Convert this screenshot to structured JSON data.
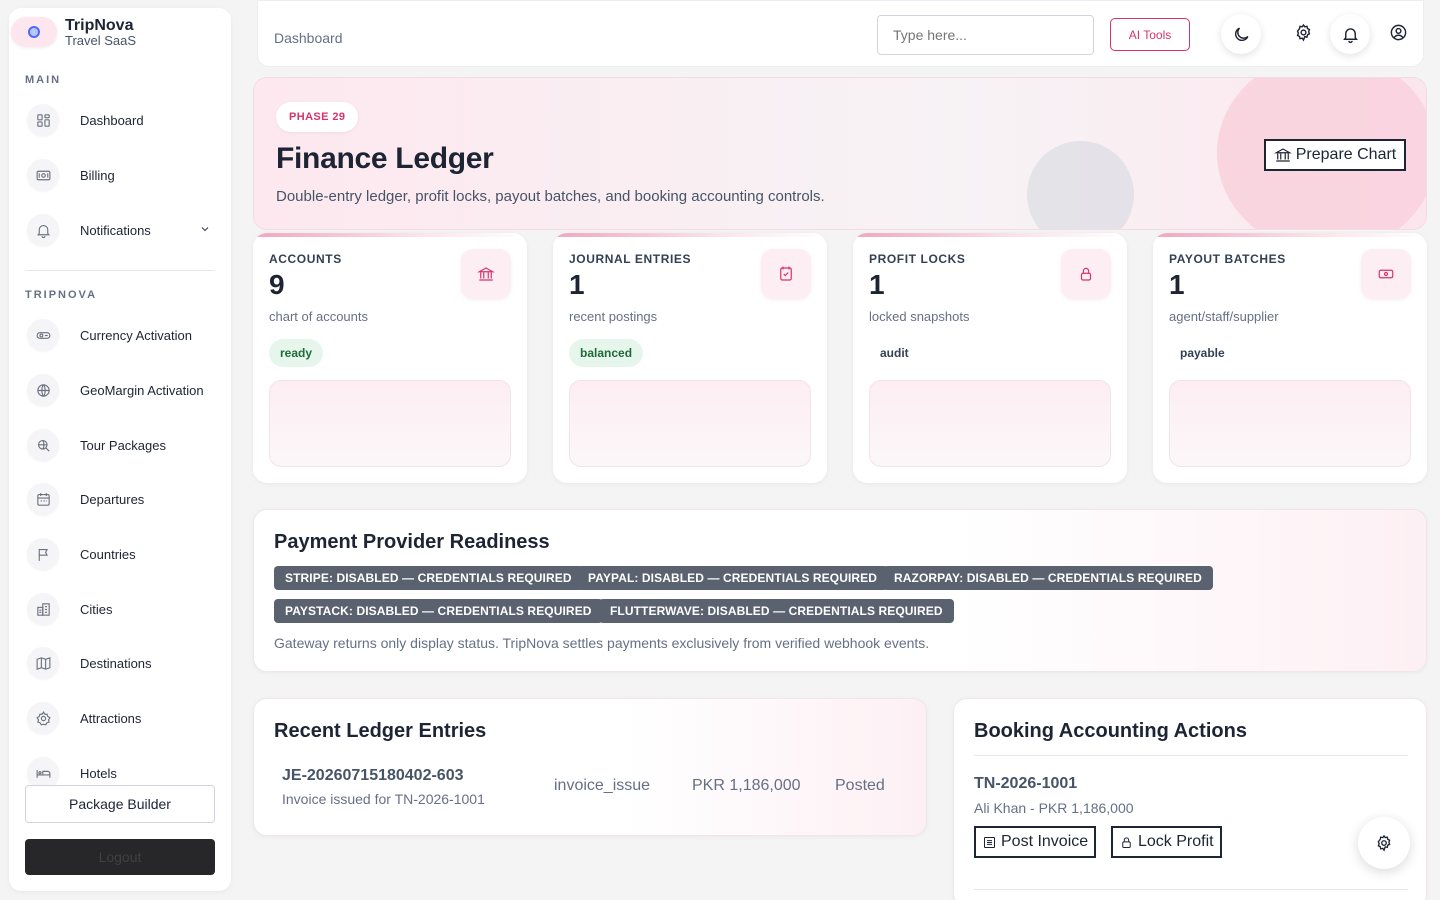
{
  "sidebar": {
    "brand": {
      "name": "TripNova",
      "subtitle": "Travel SaaS"
    },
    "main_label": "MAIN",
    "main_items": [
      {
        "label": "Dashboard",
        "icon": "dashboard-icon"
      },
      {
        "label": "Billing",
        "icon": "billing-icon"
      },
      {
        "label": "Notifications",
        "icon": "bell-icon",
        "chevron": "⌄"
      }
    ],
    "tripnova_label": "TRIPNOVA",
    "tripnova_items": [
      {
        "label": "Currency Activation",
        "icon": "currency-icon"
      },
      {
        "label": "GeoMargin Activation",
        "icon": "globe-icon"
      },
      {
        "label": "Tour Packages",
        "icon": "search-globe-icon"
      },
      {
        "label": "Departures",
        "icon": "calendar-icon"
      },
      {
        "label": "Countries",
        "icon": "flag-icon"
      },
      {
        "label": "Cities",
        "icon": "buildings-icon"
      },
      {
        "label": "Destinations",
        "icon": "map-icon"
      },
      {
        "label": "Attractions",
        "icon": "attractions-icon"
      },
      {
        "label": "Hotels",
        "icon": "bed-icon"
      }
    ],
    "package_builder": "Package Builder",
    "logout": "Logout"
  },
  "header": {
    "breadcrumb": "Dashboard",
    "search_placeholder": "Type here...",
    "ai_tools": "AI Tools"
  },
  "hero": {
    "phase": "PHASE 29",
    "title": "Finance Ledger",
    "subtitle": "Double-entry ledger, profit locks, payout batches, and booking accounting controls.",
    "prepare_chart": "Prepare Chart"
  },
  "stats": [
    {
      "label": "ACCOUNTS",
      "value": "9",
      "desc": "chart of accounts",
      "badge": "ready",
      "badge_style": "green",
      "icon": "bank-icon"
    },
    {
      "label": "JOURNAL ENTRIES",
      "value": "1",
      "desc": "recent postings",
      "badge": "balanced",
      "badge_style": "green",
      "icon": "journal-check-icon"
    },
    {
      "label": "PROFIT LOCKS",
      "value": "1",
      "desc": "locked snapshots",
      "badge": "audit",
      "badge_style": "plain",
      "icon": "lock-icon"
    },
    {
      "label": "PAYOUT BATCHES",
      "value": "1",
      "desc": "agent/staff/supplier",
      "badge": "payable",
      "badge_style": "plain",
      "icon": "cash-icon"
    }
  ],
  "providers": {
    "title": "Payment Provider Readiness",
    "items": [
      "STRIPE: DISABLED — CREDENTIALS REQUIRED",
      "PAYPAL: DISABLED — CREDENTIALS REQUIRED",
      "RAZORPAY: DISABLED — CREDENTIALS REQUIRED",
      "PAYSTACK: DISABLED — CREDENTIALS REQUIRED",
      "FLUTTERWAVE: DISABLED — CREDENTIALS REQUIRED"
    ],
    "note": "Gateway returns only display status. TripNova settles payments exclusively from verified webhook events."
  },
  "ledger": {
    "title": "Recent Ledger Entries",
    "entries": [
      {
        "id": "JE-20260715180402-603",
        "desc": "Invoice issued for TN-2026-1001",
        "type": "invoice_issue",
        "amount": "PKR 1,186,000",
        "status": "Posted"
      }
    ]
  },
  "booking": {
    "title": "Booking Accounting Actions",
    "id": "TN-2026-1001",
    "sub": "Ali Khan - PKR 1,186,000",
    "post_invoice": "Post Invoice",
    "lock_profit": "Lock Profit"
  },
  "colors": {
    "accent": "#d6336c",
    "pill_dark": "#5a6270",
    "success_bg": "#e7f6ec",
    "success_text": "#1f6b3a"
  }
}
